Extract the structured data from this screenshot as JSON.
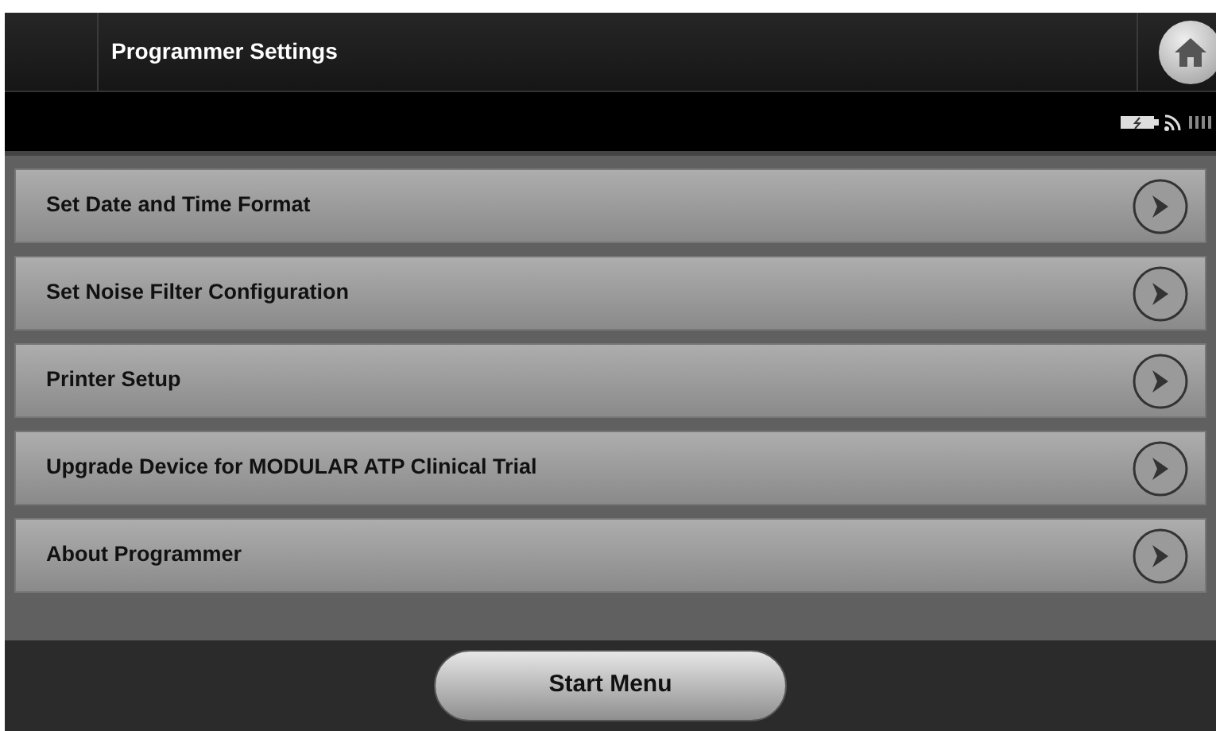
{
  "header": {
    "title": "Programmer Settings"
  },
  "menu_items": [
    {
      "label": "Set Date and Time Format"
    },
    {
      "label": "Set Noise Filter Configuration"
    },
    {
      "label": "Printer Setup"
    },
    {
      "label": "Upgrade Device for MODULAR ATP Clinical Trial"
    },
    {
      "label": "About Programmer"
    }
  ],
  "footer": {
    "button": "Start Menu"
  }
}
